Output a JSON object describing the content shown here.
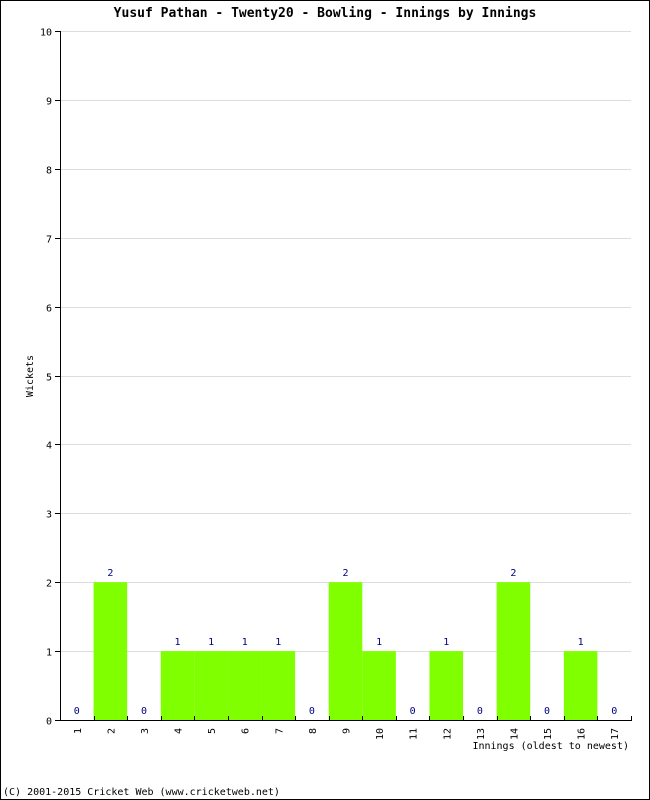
{
  "chart_data": {
    "type": "bar",
    "title": "Yusuf Pathan - Twenty20 - Bowling - Innings by Innings",
    "xlabel": "Innings (oldest to newest)",
    "ylabel": "Wickets",
    "categories": [
      "1",
      "2",
      "3",
      "4",
      "5",
      "6",
      "7",
      "8",
      "9",
      "10",
      "11",
      "12",
      "13",
      "14",
      "15",
      "16",
      "17"
    ],
    "values": [
      0,
      2,
      0,
      1,
      1,
      1,
      1,
      0,
      2,
      1,
      0,
      1,
      0,
      2,
      0,
      1,
      0
    ],
    "ylim": [
      0,
      10
    ],
    "yticks": [
      0,
      1,
      2,
      3,
      4,
      5,
      6,
      7,
      8,
      9,
      10
    ],
    "grid": true,
    "bar_color": "#80ff00",
    "label_color": "#000080",
    "grid_color": "#dddddd"
  },
  "footer": "(C) 2001-2015 Cricket Web (www.cricketweb.net)"
}
